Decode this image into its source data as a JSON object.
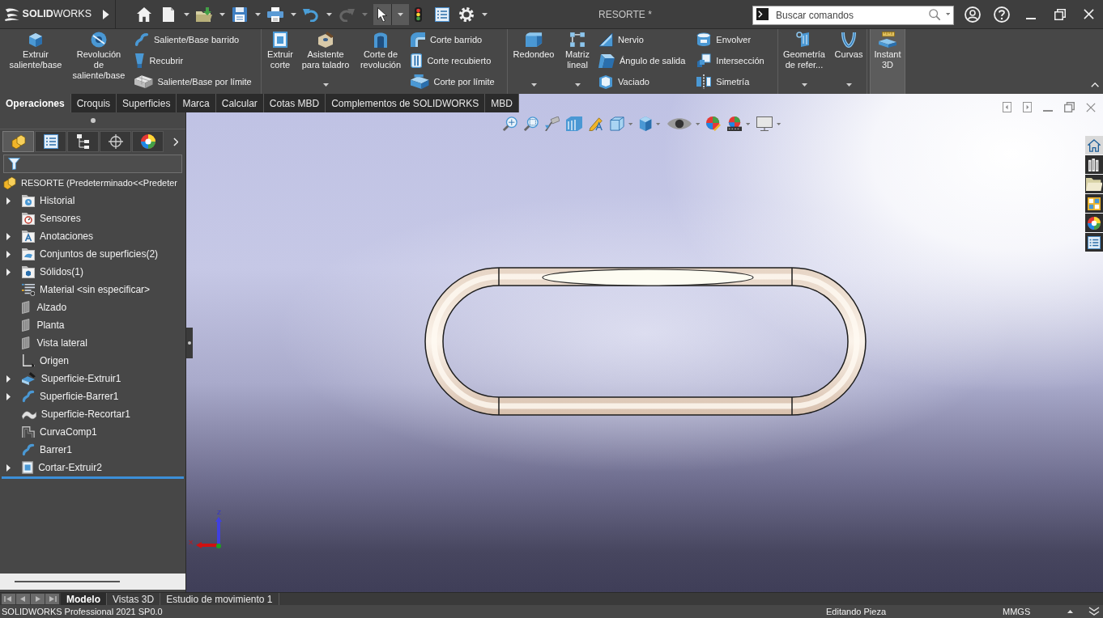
{
  "title_bar": {
    "logo": "**SOLID**WORKS",
    "document_title": "RESORTE *",
    "search": {
      "placeholder": "Buscar comandos"
    }
  },
  "quick_access": [
    {
      "dropdown": false,
      "disabled": false,
      "pressed": false
    },
    {
      "dropdown": true,
      "disabled": false,
      "pressed": false
    },
    {
      "dropdown": true,
      "disabled": false,
      "pressed": false
    },
    {
      "dropdown": true,
      "disabled": false,
      "pressed": false
    },
    {
      "dropdown": true,
      "disabled": false,
      "pressed": false
    },
    {
      "dropdown": true,
      "disabled": false,
      "pressed": false
    },
    {
      "dropdown": true,
      "disabled": true,
      "pressed": false
    },
    {
      "dropdown": true,
      "disabled": false,
      "pressed": true
    },
    {
      "dropdown": false,
      "disabled": false,
      "pressed": false
    },
    {
      "dropdown": false,
      "disabled": false,
      "pressed": false
    },
    {
      "dropdown": true,
      "disabled": false,
      "pressed": false
    }
  ],
  "command_manager": {
    "groups": [
      {
        "large": [
          {
            "label": "Extruir\nsaliente/base",
            "dropdown": false
          },
          {
            "label": "Revolución\nde\nsaliente/base",
            "dropdown": false
          }
        ],
        "columns": [
          [
            "Saliente/Base barrido",
            "Recubrir",
            "Saliente/Base por límite"
          ]
        ]
      },
      {
        "large": [
          {
            "label": "Extruir\ncorte",
            "dropdown": false
          },
          {
            "label": "Asistente\npara taladro",
            "dropdown": true
          },
          {
            "label": "Corte de\nrevolución",
            "dropdown": false
          }
        ],
        "columns": [
          [
            "Corte barrido",
            "Corte recubierto",
            "Corte por límite"
          ]
        ]
      },
      {
        "large": [
          {
            "label": "Redondeo",
            "dropdown": true
          },
          {
            "label": "Matriz\nlineal",
            "dropdown": true
          }
        ],
        "columns": [
          [
            "Nervio",
            "Ángulo de salida",
            "Vaciado"
          ],
          [
            "Envolver",
            "Intersección",
            "Simetría"
          ]
        ]
      },
      {
        "large": [
          {
            "label": "Geometría\nde refer...",
            "dropdown": true
          },
          {
            "label": "Curvas",
            "dropdown": true
          }
        ]
      }
    ],
    "instant_3d": {
      "label": "Instant\n3D",
      "on": true
    }
  },
  "tabs": [
    {
      "label": "Operaciones",
      "selected": true
    },
    {
      "label": "Croquis",
      "selected": false
    },
    {
      "label": "Superficies",
      "selected": false
    },
    {
      "label": "Marca",
      "selected": false
    },
    {
      "label": "Calcular",
      "selected": false
    },
    {
      "label": "Cotas MBD",
      "selected": false
    },
    {
      "label": "Complementos de SOLIDWORKS",
      "selected": false
    },
    {
      "label": "MBD",
      "selected": false
    }
  ],
  "feature_manager": {
    "panel_tabs": [
      {
        "selected": true
      },
      {
        "selected": false
      },
      {
        "selected": false
      },
      {
        "selected": false
      },
      {
        "selected": false
      }
    ],
    "tree": {
      "label": "RESORTE (Predeterminado<<Predeter",
      "children": [
        {
          "label": "Historial",
          "expandable": true
        },
        {
          "label": "Sensores",
          "expandable": false
        },
        {
          "label": "Anotaciones",
          "expandable": true
        },
        {
          "label": "Conjuntos de superficies(2)",
          "expandable": true
        },
        {
          "label": "Sólidos(1)",
          "expandable": true
        },
        {
          "label": "Material <sin especificar>",
          "expandable": false
        },
        {
          "label": "Alzado",
          "expandable": false
        },
        {
          "label": "Planta",
          "expandable": false
        },
        {
          "label": "Vista lateral",
          "expandable": false
        },
        {
          "label": "Origen",
          "expandable": false
        },
        {
          "label": "Superficie-Extruir1",
          "expandable": true
        },
        {
          "label": "Superficie-Barrer1",
          "expandable": true
        },
        {
          "label": "Superficie-Recortar1",
          "expandable": false
        },
        {
          "label": "CurvaComp1",
          "expandable": false
        },
        {
          "label": "Barrer1",
          "expandable": false
        },
        {
          "label": "Cortar-Extruir2",
          "expandable": true
        }
      ]
    }
  },
  "graphics_area": {
    "task_pane": [
      {
        "selected": true
      },
      {
        "selected": false
      },
      {
        "selected": false
      },
      {
        "selected": false
      },
      {
        "selected": false
      },
      {
        "selected": false
      }
    ],
    "triad": {
      "z_label": "Z",
      "x_label": "X"
    }
  },
  "bottom_tabs": [
    {
      "label": "Modelo",
      "selected": true
    },
    {
      "label": "Vistas 3D",
      "selected": false
    },
    {
      "label": "Estudio de movimiento 1",
      "selected": false
    }
  ],
  "status_bar": {
    "product": "SOLIDWORKS Professional 2021 SP0.0",
    "mode": "Editando Pieza",
    "units": "MMGS"
  }
}
